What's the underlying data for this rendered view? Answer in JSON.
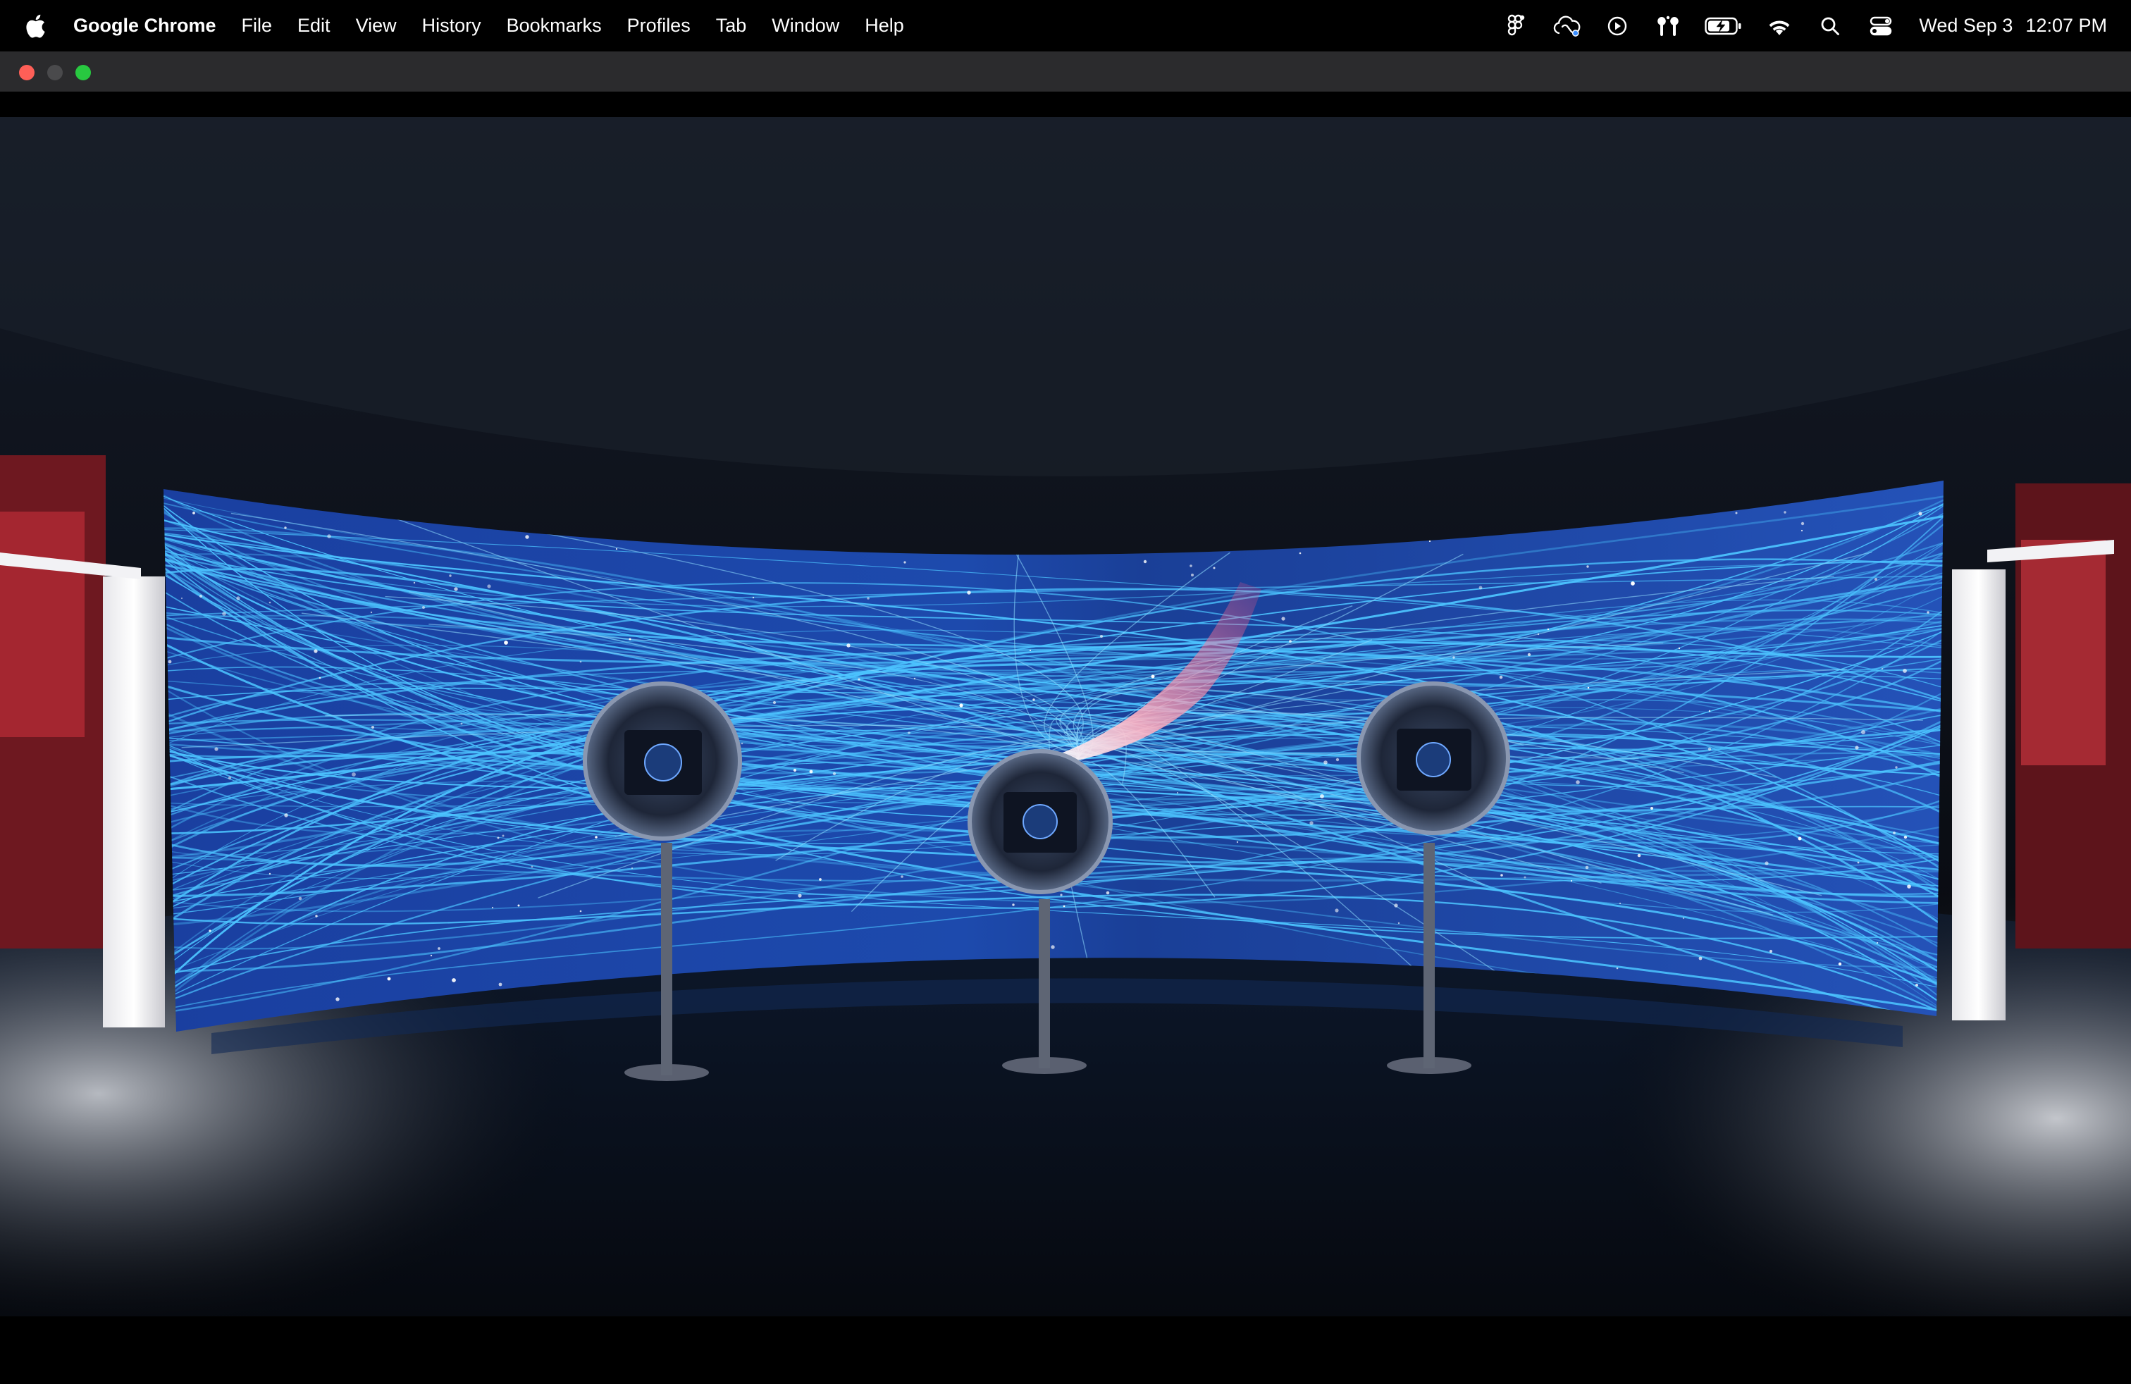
{
  "menubar": {
    "app_name": "Google Chrome",
    "items": [
      "File",
      "Edit",
      "View",
      "History",
      "Bookmarks",
      "Profiles",
      "Tab",
      "Window",
      "Help"
    ],
    "status_icons": [
      "figma-icon",
      "creative-cloud-icon",
      "play-circle-icon",
      "airpods-icon",
      "battery-charging-icon",
      "wifi-icon",
      "spotlight-search-icon",
      "control-center-icon"
    ],
    "date": "Wed Sep 3",
    "time": "12:07 PM"
  },
  "window": {
    "traffic_lights": [
      "close",
      "minimize",
      "zoom"
    ]
  },
  "colors": {
    "screen_blue": "#1f4ea8",
    "light_lines": "#4cc4ff",
    "accent_pink": "#ff6a8a",
    "room_dark": "#0b0e16",
    "red_wall": "#8c1c24"
  }
}
